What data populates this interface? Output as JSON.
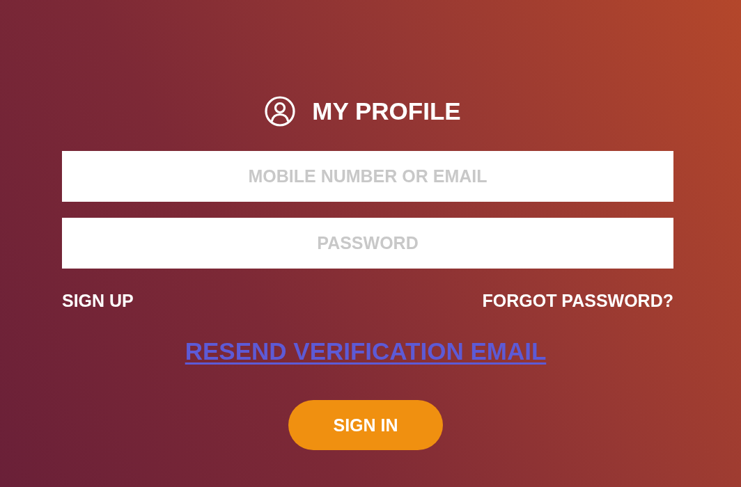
{
  "header": {
    "title": "MY PROFILE"
  },
  "fields": [
    {
      "placeholder": "MOBILE NUMBER OR EMAIL"
    },
    {
      "placeholder": "PASSWORD"
    }
  ],
  "links": {
    "sign_up": "SIGN UP",
    "forgot_password": "FORGOT PASSWORD?"
  },
  "resend_link": "RESEND VERIFICATION EMAIL",
  "submit_button": "SIGN IN"
}
